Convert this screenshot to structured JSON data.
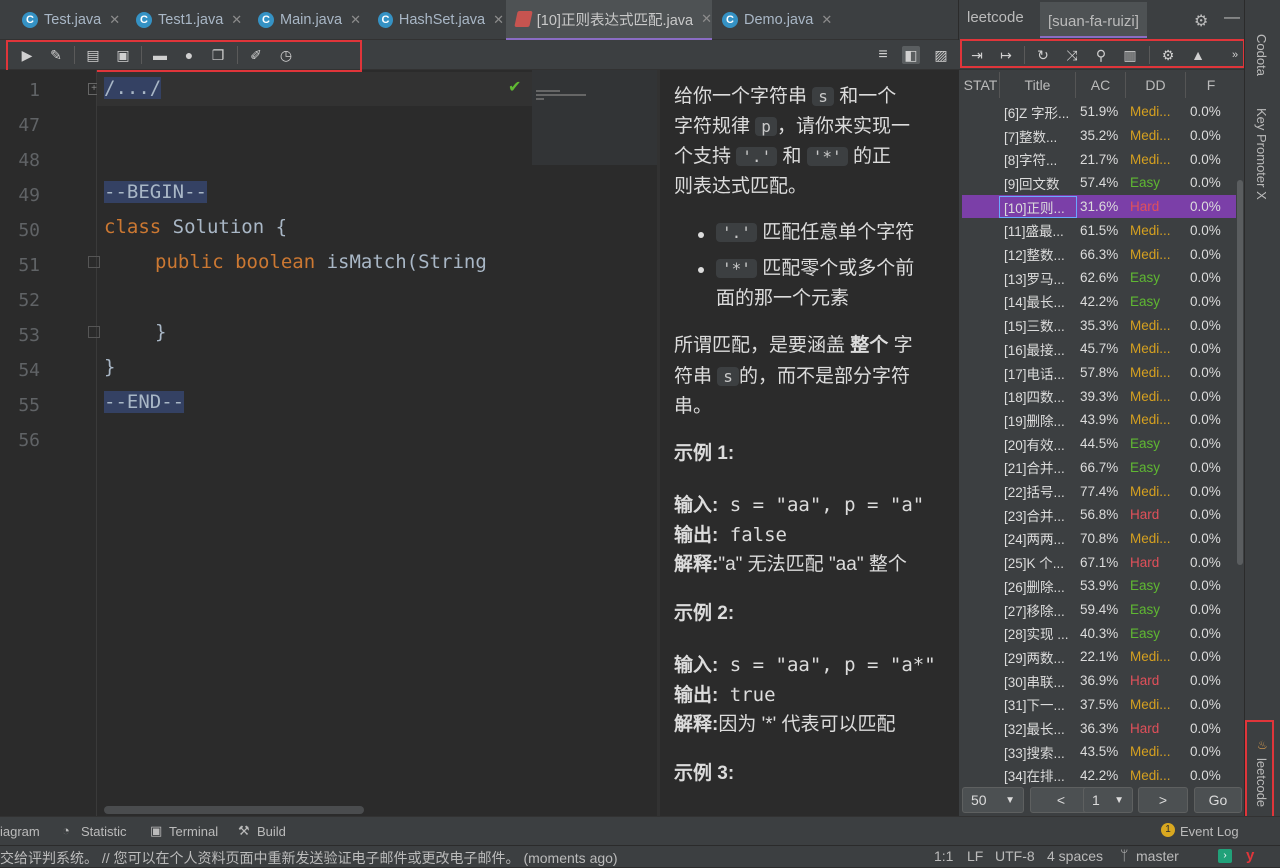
{
  "tabs": [
    {
      "label": "Test.java",
      "icon": "C"
    },
    {
      "label": "Test1.java",
      "icon": "C"
    },
    {
      "label": "Main.java",
      "icon": "C"
    },
    {
      "label": "HashSet.java",
      "icon": "C"
    },
    {
      "label": "[10]正则表达式匹配.java",
      "icon": ""
    },
    {
      "label": "Demo.java",
      "icon": "C"
    }
  ],
  "editor": {
    "line_numbers": [
      "1",
      "47",
      "48",
      "49",
      "50",
      "51",
      "52",
      "53",
      "54",
      "55",
      "56"
    ],
    "folded": "/.../",
    "begin": "--BEGIN--",
    "class_kw": "class",
    "class_name": " Solution {",
    "public_kw": "public",
    "boolean_kw": "boolean",
    "method": " isMatch(String",
    "close_inner": "}",
    "close_outer": "}",
    "end": "--END--"
  },
  "description": {
    "p1a": "给你一个字符串",
    "s": "s",
    "p1b": "和一个",
    "p1c": "字符规律",
    "p": "p",
    "p1d": "，请你来实现一",
    "p1e": "个支持",
    "dot": "'.'",
    "and": "和",
    "star": "'*'",
    "p1f": "的正",
    "p1g": "则表达式匹配。",
    "li1": "匹配任意单个字符",
    "li2a": "匹配零个或多个前",
    "li2b": "面的那一个元素",
    "p2a": "所谓匹配，是要涵盖",
    "p2b": "整个",
    "p2c": "字",
    "p2d": "符串",
    "p2e": "的，而不是部分字符",
    "p2f": "串。",
    "ex1": "示例 1:",
    "in_label": "输入:",
    "out_label": "输出:",
    "exp_label": "解释:",
    "ex1_in": " s = \"aa\", p = \"a\"",
    "ex1_out": " false",
    "ex1_exp": "\"a\" 无法匹配 \"aa\" 整个",
    "ex2": "示例 2:",
    "ex2_in": " s = \"aa\", p = \"a*\"",
    "ex2_out": " true",
    "ex2_exp": "因为 '*' 代表可以匹配",
    "ex3": "示例 3:"
  },
  "leetcode_panel": {
    "tab1": "leetcode",
    "tab2": "[suan-fa-ruizi]",
    "headers": [
      "STAT",
      "Title",
      "AC",
      "DD",
      "F"
    ],
    "rows": [
      {
        "title": "[6]Z 字形...",
        "ac": "51.9%",
        "dd": "Medi...",
        "f": "0.0%"
      },
      {
        "title": "[7]整数...",
        "ac": "35.2%",
        "dd": "Medi...",
        "f": "0.0%"
      },
      {
        "title": "[8]字符...",
        "ac": "21.7%",
        "dd": "Medi...",
        "f": "0.0%"
      },
      {
        "title": "[9]回文数",
        "ac": "57.4%",
        "dd": "Easy",
        "f": "0.0%"
      },
      {
        "title": "[10]正则...",
        "ac": "31.6%",
        "dd": "Hard",
        "f": "0.0%"
      },
      {
        "title": "[11]盛最...",
        "ac": "61.5%",
        "dd": "Medi...",
        "f": "0.0%"
      },
      {
        "title": "[12]整数...",
        "ac": "66.3%",
        "dd": "Medi...",
        "f": "0.0%"
      },
      {
        "title": "[13]罗马...",
        "ac": "62.6%",
        "dd": "Easy",
        "f": "0.0%"
      },
      {
        "title": "[14]最长...",
        "ac": "42.2%",
        "dd": "Easy",
        "f": "0.0%"
      },
      {
        "title": "[15]三数...",
        "ac": "35.3%",
        "dd": "Medi...",
        "f": "0.0%"
      },
      {
        "title": "[16]最接...",
        "ac": "45.7%",
        "dd": "Medi...",
        "f": "0.0%"
      },
      {
        "title": "[17]电话...",
        "ac": "57.8%",
        "dd": "Medi...",
        "f": "0.0%"
      },
      {
        "title": "[18]四数...",
        "ac": "39.3%",
        "dd": "Medi...",
        "f": "0.0%"
      },
      {
        "title": "[19]删除...",
        "ac": "43.9%",
        "dd": "Medi...",
        "f": "0.0%"
      },
      {
        "title": "[20]有效...",
        "ac": "44.5%",
        "dd": "Easy",
        "f": "0.0%"
      },
      {
        "title": "[21]合并...",
        "ac": "66.7%",
        "dd": "Easy",
        "f": "0.0%"
      },
      {
        "title": "[22]括号...",
        "ac": "77.4%",
        "dd": "Medi...",
        "f": "0.0%"
      },
      {
        "title": "[23]合并...",
        "ac": "56.8%",
        "dd": "Hard",
        "f": "0.0%"
      },
      {
        "title": "[24]两两...",
        "ac": "70.8%",
        "dd": "Medi...",
        "f": "0.0%"
      },
      {
        "title": "[25]K 个...",
        "ac": "67.1%",
        "dd": "Hard",
        "f": "0.0%"
      },
      {
        "title": "[26]删除...",
        "ac": "53.9%",
        "dd": "Easy",
        "f": "0.0%"
      },
      {
        "title": "[27]移除...",
        "ac": "59.4%",
        "dd": "Easy",
        "f": "0.0%"
      },
      {
        "title": "[28]实现 ...",
        "ac": "40.3%",
        "dd": "Easy",
        "f": "0.0%"
      },
      {
        "title": "[29]两数...",
        "ac": "22.1%",
        "dd": "Medi...",
        "f": "0.0%"
      },
      {
        "title": "[30]串联...",
        "ac": "36.9%",
        "dd": "Hard",
        "f": "0.0%"
      },
      {
        "title": "[31]下一...",
        "ac": "37.5%",
        "dd": "Medi...",
        "f": "0.0%"
      },
      {
        "title": "[32]最长...",
        "ac": "36.3%",
        "dd": "Hard",
        "f": "0.0%"
      },
      {
        "title": "[33]搜索...",
        "ac": "43.5%",
        "dd": "Medi...",
        "f": "0.0%"
      },
      {
        "title": "[34]在排...",
        "ac": "42.2%",
        "dd": "Medi...",
        "f": "0.0%"
      }
    ],
    "page_size": "50",
    "prev": "<",
    "page": "1",
    "next": ">",
    "go": "Go"
  },
  "right_strip": {
    "codota": "Codota",
    "key_promoter": "Key Promoter X",
    "leetcode": "leetcode"
  },
  "bottom_tools": {
    "diagram": "iagram",
    "statistic": "Statistic",
    "terminal": "Terminal",
    "build": "Build",
    "event_log": "Event Log"
  },
  "status": {
    "message": "交给评判系统。 // 您可以在个人资料页面中重新发送验证电子邮件或更改电子邮件。 (moments ago)",
    "position": "1:1",
    "line_sep": "LF",
    "encoding": "UTF-8",
    "indent": "4 spaces",
    "branch": "master"
  },
  "colors": {
    "easy": "#5fb832",
    "medium": "#d5a020",
    "hard": "#e0505a",
    "selected_row": "#7b3fa8",
    "highlight": "#e0353a"
  }
}
